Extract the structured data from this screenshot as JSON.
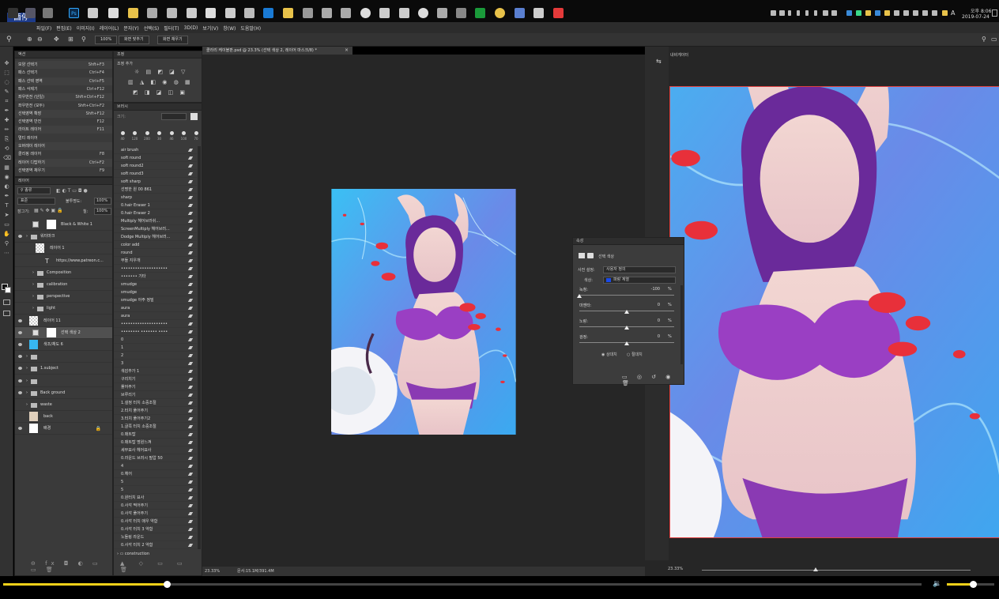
{
  "taskbar": {
    "start_label": "酉停",
    "clock_time": "오후 8:06",
    "clock_date": "2019-07-24",
    "lang": "A"
  },
  "menu": [
    "파일(F)",
    "편집(E)",
    "이미지(I)",
    "레이어(L)",
    "문자(Y)",
    "선택(S)",
    "필터(T)",
    "3D(D)",
    "보기(V)",
    "창(W)",
    "도움말(H)"
  ],
  "options": {
    "zoom_value": "100%",
    "fit_screen": "화면 맞추기",
    "fill_screen": "화면 채우기"
  },
  "actions": {
    "title": "액션",
    "items": [
      {
        "label": "모양 선택기",
        "key": "Shft+F3"
      },
      {
        "label": "패스 선택기",
        "key": "Ctrl+F4"
      },
      {
        "label": "패스 선택 영역",
        "key": "Ctrl+F5"
      },
      {
        "label": "패스 삭제기",
        "key": "Ctrl+F12"
      },
      {
        "label": "좌우반전 (단일)",
        "key": "Shft+Ctrl+F12"
      },
      {
        "label": "좌우반전 (모두)",
        "key": "Shft+Ctrl+F2"
      },
      {
        "label": "선택영역 확장",
        "key": "Shft+F12"
      },
      {
        "label": "선택영역 반전",
        "key": "F12"
      },
      {
        "label": "라이트 레이어",
        "key": "F11"
      },
      {
        "label": "멀티 레이어",
        "key": ""
      },
      {
        "label": "오버레이 레이어",
        "key": ""
      },
      {
        "label": "클리핑 레이어",
        "key": "F8"
      },
      {
        "label": "레이어 디탑하기",
        "key": "Ctrl+F2"
      },
      {
        "label": "선택영역 채우기",
        "key": "F9"
      }
    ]
  },
  "layers": {
    "title": "레이어",
    "filter_label": "종류",
    "blend_mode": "표준",
    "opacity_label": "불투명도:",
    "opacity_value": "100%",
    "lock_label": "잠그기:",
    "fill_label": "칠:",
    "fill_value": "100%",
    "items": [
      {
        "label": "Black & White 1",
        "indent": 0,
        "eye": false,
        "kind": "adj"
      },
      {
        "label": "워터마크",
        "indent": 0,
        "eye": true,
        "kind": "folder"
      },
      {
        "label": "레이어 1",
        "indent": 1,
        "eye": false,
        "kind": "layer"
      },
      {
        "label": "https://www.patreon.c...",
        "indent": 1,
        "eye": false,
        "kind": "text"
      },
      {
        "label": "Composition",
        "indent": 1,
        "eye": false,
        "kind": "folder"
      },
      {
        "label": "calibration",
        "indent": 1,
        "eye": false,
        "kind": "folder"
      },
      {
        "label": "perspective",
        "indent": 1,
        "eye": false,
        "kind": "folder"
      },
      {
        "label": "light",
        "indent": 1,
        "eye": false,
        "kind": "folder"
      },
      {
        "label": "레이어 11",
        "indent": 0,
        "eye": true,
        "kind": "layer"
      },
      {
        "label": "선택 색상 2",
        "indent": 0,
        "eye": true,
        "kind": "adj"
      },
      {
        "label": "색조/채도 6",
        "indent": 0,
        "eye": true,
        "kind": "img"
      },
      {
        "label": "",
        "indent": 0,
        "eye": true,
        "kind": "folder"
      },
      {
        "label": "1.subject",
        "indent": 0,
        "eye": true,
        "kind": "folder"
      },
      {
        "label": "",
        "indent": 0,
        "eye": true,
        "kind": "folder"
      },
      {
        "label": "Back ground",
        "indent": 0,
        "eye": true,
        "kind": "folder"
      },
      {
        "label": "waste",
        "indent": 0,
        "eye": false,
        "kind": "folder"
      },
      {
        "label": "back",
        "indent": 0,
        "eye": false,
        "kind": "beige"
      },
      {
        "label": "배경",
        "indent": 0,
        "eye": true,
        "kind": "white"
      }
    ]
  },
  "adjust": {
    "title": "조정",
    "add_label": "조정 추가"
  },
  "brushes": {
    "title": "브러시",
    "size_label": "크기:",
    "sizes": [
      "40",
      "120",
      "200",
      "30",
      "46",
      "100",
      "70"
    ],
    "items": [
      "air brush",
      "soft round",
      "soft round2",
      "soft round3",
      "soft sharp",
      "선명한 원 00 861",
      "sharp",
      "0.hair Eraser 1",
      "0.hair Eraser 2",
      "Multiply 헤어브러쉬...",
      "ScreenMultiply 헤어브러...",
      "Dodge Multiply 헤어브러...",
      "color add",
      "round",
      "부들 지우개",
      "••••••••••••••••••••",
      "•••••••  기타",
      "smudge",
      "smudge",
      "smudge 아주 정밀",
      "aura",
      "aura",
      "••••••••••••••••••••",
      "•••••••• ••••••• ••••",
      "0",
      "1",
      "2",
      "3",
      "색감추가 1",
      "구리치기",
      "풀어주기",
      "브루리기",
      "1.설정 터치 소중조절",
      "2.터치 풀어주기",
      "3.터치 풀어주기2",
      "1.글쪽 터치 소중조절",
      "0.매트탑",
      "0.매트탑 명원느껴",
      "세부묘사 헤어묘사",
      "0.라운드 브러시 필압 50",
      "4",
      "0.헤어",
      "5",
      "5",
      "0.원터치 묘사",
      "0.사각 찍어주기",
      "0.사각 풀어주기",
      "0.사각 터치 매우 약함",
      "0.사각 터치 3 약함",
      "노들링 라운드",
      "0.사각 터치 2 약함"
    ],
    "footer": "construction"
  },
  "document": {
    "tab_label": "클라리 케이블판.psd @ 23.3% (선택 색상 2, 레이어 마스크/8) *",
    "zoom": "23.33%",
    "doc_size": "문서:15.1M/391.4M"
  },
  "navigator": {
    "title": "내비게이터",
    "zoom": "23.33%"
  },
  "properties": {
    "title": "속성",
    "panel_label": "선택 색상",
    "preset_label": "사전 설정:",
    "preset_value": "사용자 정의",
    "colors_label": "색상:",
    "colors_value": "파랑 계열",
    "sliders": [
      {
        "label": "녹청:",
        "value": "-100",
        "unit": "%",
        "frac": 0.0
      },
      {
        "label": "마젠타:",
        "value": "0",
        "unit": "%",
        "frac": 0.5
      },
      {
        "label": "노랑:",
        "value": "0",
        "unit": "%",
        "frac": 0.5
      },
      {
        "label": "검정:",
        "value": "0",
        "unit": "%",
        "frac": 0.5
      }
    ],
    "method_relative": "상대치",
    "method_absolute": "절대치"
  },
  "player": {
    "progress": 0.178,
    "volume": 0.55
  },
  "colors": {
    "accent": "#f2d21a",
    "panel": "#3a3a3a",
    "pool": "#37b6f0",
    "bikini": "#9a3fc3",
    "hair": "#6a2a9a",
    "petal": "#e8303a"
  }
}
